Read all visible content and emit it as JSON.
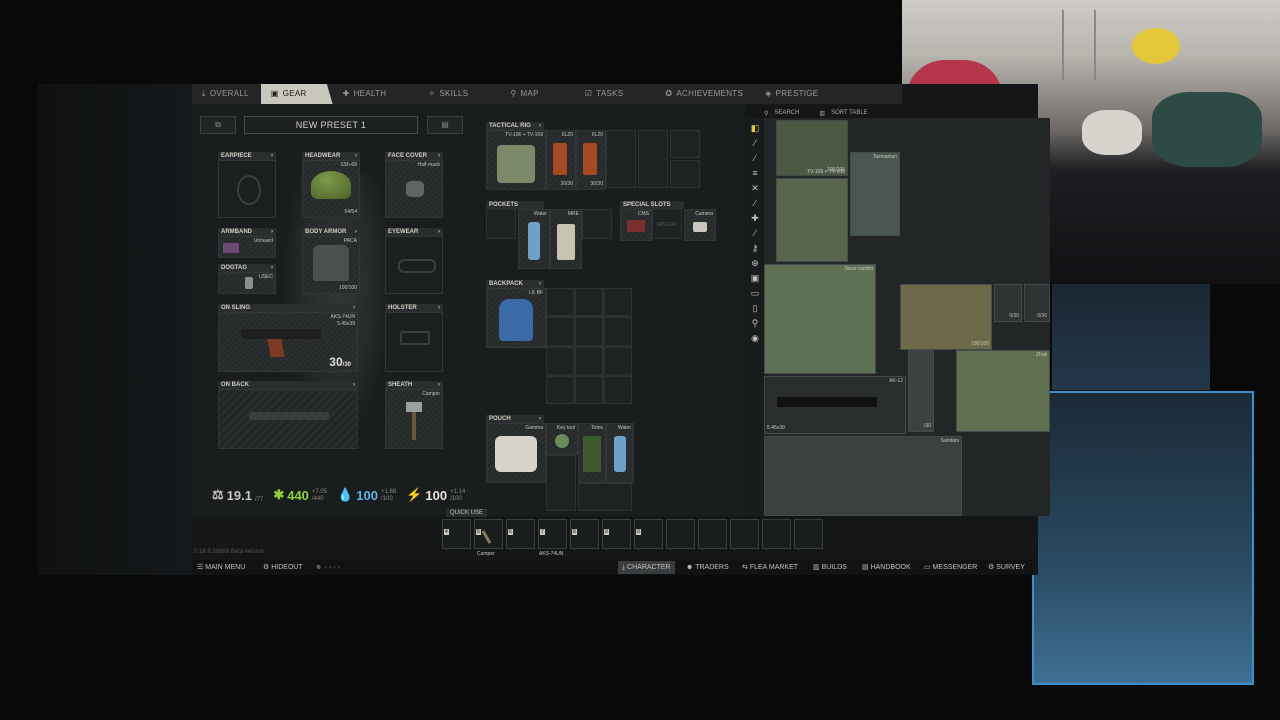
{
  "tabs": [
    {
      "label": "OVERALL",
      "icon": "download-icon"
    },
    {
      "label": "GEAR",
      "icon": "gear-bag-icon"
    },
    {
      "label": "HEALTH",
      "icon": "health-icon"
    },
    {
      "label": "SKILLS",
      "icon": "skills-icon"
    },
    {
      "label": "MAP",
      "icon": "map-pin-icon"
    },
    {
      "label": "TASKS",
      "icon": "tasks-icon"
    },
    {
      "label": "ACHIEVEMENTS",
      "icon": "achievements-icon"
    },
    {
      "label": "PRESTIGE",
      "icon": "prestige-icon"
    }
  ],
  "preset": {
    "name": "NEW PRESET 1"
  },
  "slots": {
    "earpiece": "EARPIECE",
    "headwear": {
      "label": "HEADWEAR",
      "item": "SSh-68",
      "count": "54/54"
    },
    "face_cover": {
      "label": "FACE COVER",
      "item": "Half-mask"
    },
    "armband": {
      "label": "ARMBAND",
      "item": "Unheard"
    },
    "body_armor": {
      "label": "BODY ARMOR",
      "item": "PACA",
      "count": "100/100"
    },
    "eyewear": "EYEWEAR",
    "dogtag": {
      "label": "DOGTAG",
      "item": "USEC"
    },
    "on_sling": {
      "label": "ON SLING",
      "item": "AKS-74UN",
      "caliber": "5.45x39",
      "ammo": "30",
      "ammo_max": "/30"
    },
    "holster": "HOLSTER",
    "on_back": "ON BACK",
    "sheath": {
      "label": "SHEATH",
      "item": "Camper"
    }
  },
  "rig": {
    "label": "TACTICAL RIG",
    "item": "TV-106 + TV-109",
    "mags": [
      {
        "name": "6L20",
        "count": "30/30"
      },
      {
        "name": "6L20",
        "count": "30/30"
      }
    ]
  },
  "pockets": {
    "label": "POCKETS",
    "items": [
      "Water",
      "MRE"
    ]
  },
  "special": {
    "label": "SPECIAL SLOTS",
    "items": [
      "CMS",
      "SPECIAL",
      "Camera"
    ]
  },
  "backpack": {
    "label": "BACKPACK",
    "item": "LK BF"
  },
  "pouch": {
    "label": "POUCH",
    "items": [
      "Gamma",
      "Key tool",
      "Tetris",
      "Water"
    ]
  },
  "stats": [
    {
      "value": "19.1",
      "sub": "/77",
      "color": "#c9c6bc",
      "icon": "weight-icon"
    },
    {
      "value": "440",
      "sub": "/440",
      "delta": "+7.05",
      "color": "#8fd13a",
      "icon": "health-cross-icon"
    },
    {
      "value": "100",
      "sub": "/100",
      "delta": "+1.88",
      "color": "#5fb4e6",
      "icon": "hydration-icon"
    },
    {
      "value": "100",
      "sub": "/100",
      "delta": "+1.14",
      "color": "#e6e3d8",
      "icon": "energy-icon"
    }
  ],
  "quick_use": {
    "label": "QUICK USE",
    "slots": [
      "4",
      "5",
      "6",
      "7",
      "8",
      "9",
      "0",
      "",
      "",
      "",
      "",
      ""
    ],
    "items": {
      "1": "Camper",
      "3": "AKS-74UN"
    }
  },
  "version": "0.16.8.38889 Beta version",
  "bottom_nav_left": [
    {
      "label": "MAIN MENU",
      "icon": "menu-icon"
    },
    {
      "label": "HIDEOUT",
      "icon": "hideout-icon"
    }
  ],
  "bottom_nav_right": [
    {
      "label": "CHARACTER",
      "icon": "character-icon",
      "active": true
    },
    {
      "label": "TRADERS",
      "icon": "traders-icon"
    },
    {
      "label": "FLEA MARKET",
      "icon": "flea-market-icon"
    },
    {
      "label": "BUILDS",
      "icon": "builds-icon"
    },
    {
      "label": "HANDBOOK",
      "icon": "handbook-icon"
    },
    {
      "label": "MESSENGER",
      "icon": "messenger-icon"
    },
    {
      "label": "SURVEY",
      "icon": "survey-icon"
    }
  ],
  "stash": {
    "search_label": "SEARCH",
    "sort_label": "SORT TABLE",
    "items": [
      {
        "name": "TV-109 + TV-106",
        "count": "205/205"
      },
      {
        "name": "Tasmanian"
      },
      {
        "name": "Tavor combo"
      },
      {
        "name": "",
        "count": "100/100"
      },
      {
        "name": "",
        "count": "0/30"
      },
      {
        "name": "",
        "count": "0/30"
      },
      {
        "name": "AK-12",
        "caliber": "5.45x39"
      },
      {
        "name": "Zhuk"
      },
      {
        "name": "",
        "count": "/30"
      },
      {
        "name": "Sanitars"
      }
    ]
  }
}
